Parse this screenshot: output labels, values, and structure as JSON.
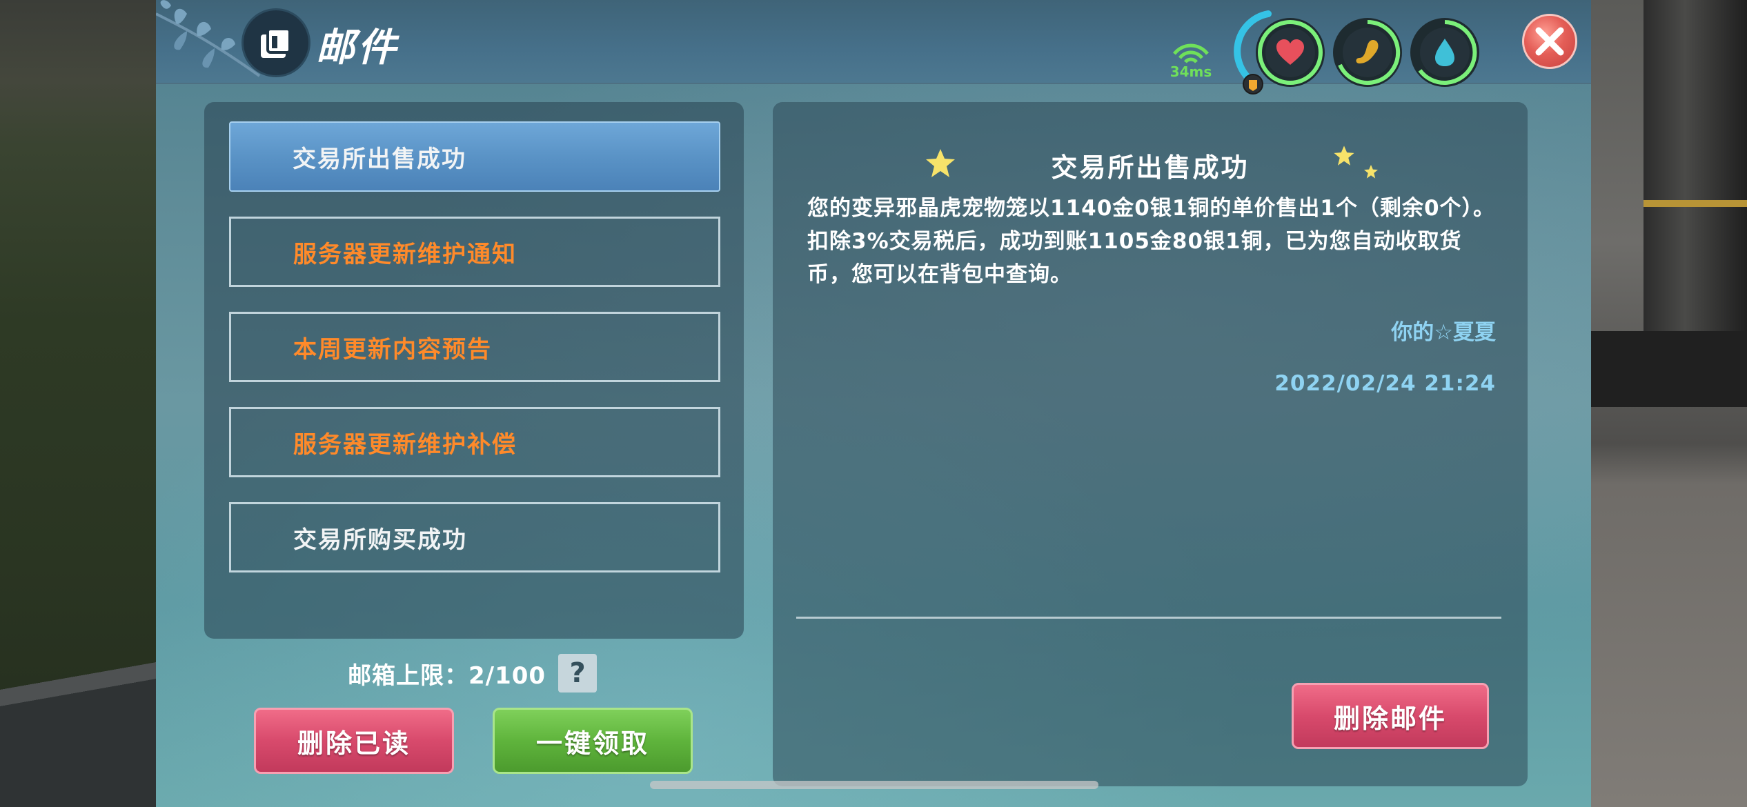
{
  "window": {
    "title": "邮件",
    "ping": "34ms"
  },
  "status_rings": [
    {
      "name": "health",
      "color": "#e8505c",
      "ring_color": "#7bf07a"
    },
    {
      "name": "hunger",
      "color": "#e0a82a",
      "ring_color": "#7bf07a"
    },
    {
      "name": "water",
      "color": "#3fc0d8",
      "ring_color": "#7bf07a"
    }
  ],
  "mail_list": [
    {
      "label": "交易所出售成功",
      "selected": true,
      "color": "white"
    },
    {
      "label": "服务器更新维护通知",
      "selected": false,
      "color": "orange"
    },
    {
      "label": "本周更新内容预告",
      "selected": false,
      "color": "orange"
    },
    {
      "label": "服务器更新维护补偿",
      "selected": false,
      "color": "orange"
    },
    {
      "label": "交易所购买成功",
      "selected": false,
      "color": "white"
    }
  ],
  "mailbox_limit": "邮箱上限：2/100",
  "help_label": "?",
  "buttons": {
    "delete_read": "删除已读",
    "claim_all": "一键领取",
    "delete_mail": "删除邮件"
  },
  "mail_content": {
    "title": "交易所出售成功",
    "body": "您的变异邪晶虎宠物笼以1140金0银1铜的单价售出1个（剩余0个）。扣除3%交易税后，成功到账1105金80银1铜，已为您自动收取货币，您可以在背包中查询。",
    "signature": "你的☆夏夏",
    "date": "2022/02/24 21:24"
  },
  "colors": {
    "accent_blue": "#5a93c6",
    "orange_text": "#ff8a2a",
    "red_button": "#d84a6c",
    "green_button": "#5fb43c",
    "signature_blue": "#8fd3f2"
  }
}
